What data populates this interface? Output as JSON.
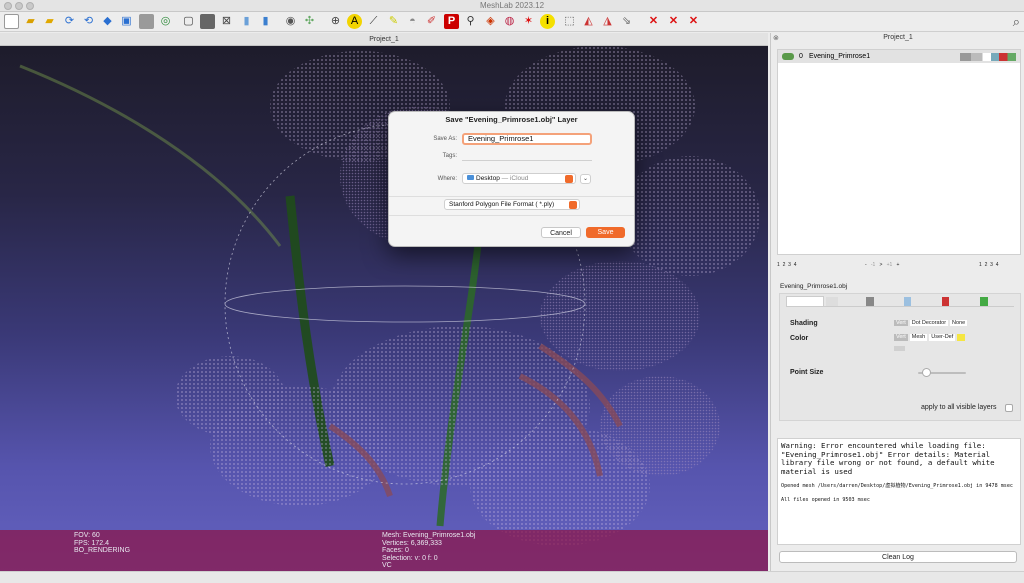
{
  "app": {
    "title": "MeshLab 2023.12"
  },
  "viewport": {
    "tab_title": "Project_1"
  },
  "info_left": {
    "fov": "FOV: 60",
    "fps": "FPS:   172.4",
    "render": "BO_RENDERING"
  },
  "info_right": {
    "mesh": "Mesh: Evening_Primrose1.obj",
    "vertices": "Vertices: 6,369,333",
    "faces": "Faces: 0",
    "selection": "Selection: v: 0 f: 0",
    "vc": "VC"
  },
  "dock": {
    "title": "Project_1"
  },
  "layers": [
    {
      "index": "0",
      "name": "Evening_Primrose1"
    }
  ],
  "pager": {
    "left": [
      "1",
      "2",
      "3",
      "4"
    ],
    "mid": [
      "-",
      "-1",
      ">",
      "+1",
      "+"
    ],
    "right": [
      "1",
      "2",
      "3",
      "4"
    ]
  },
  "panel": {
    "layer_name": "Evening_Primrose1.obj",
    "shading_label": "Shading",
    "shading_options": [
      "Vert",
      "Dot Decorator",
      "None"
    ],
    "color_label": "Color",
    "color_options": [
      "Vert",
      "Mesh",
      "User-Def"
    ],
    "user_color": "#f5e642",
    "point_size_label": "Point Size",
    "point_size_level": 0.1,
    "apply_all": "apply to all visible layers"
  },
  "log": {
    "warning": "Warning: Error encountered while loading file: \"Evening_Primrose1.obj\" Error details: Material library file wrong or not found, a default white material is used",
    "opened": "Opened mesh /Users/darren/Desktop/虚拟植物/Evening_Primrose1.obj in 9478 msec",
    "all_files": "All files opened in 9503 msec",
    "clean_label": "Clean Log"
  },
  "dialog": {
    "title": "Save \"Evening_Primrose1.obj\" Layer",
    "save_as_label": "Save As:",
    "save_as_value": "Evening_Primrose1",
    "tags_label": "Tags:",
    "where_label": "Where:",
    "where_value": "Desktop",
    "where_suffix": "— iCloud",
    "format_value": "Stanford Polygon File Format ( *.ply)",
    "cancel_label": "Cancel",
    "save_label": "Save"
  },
  "colors": {
    "accent": "#f06a2a",
    "info_bar": "#8c1446",
    "viewport_bottom": "#6462c0"
  },
  "toolbar_icons": [
    "new-icon",
    "open-icon",
    "open-folder-icon",
    "save-icon",
    "reload-icon",
    "reload-all-icon",
    "snapshot-icon",
    "camera-icon",
    "layers-icon",
    "stack-icon",
    "box-icon",
    "wireframe-icon",
    "points-icon",
    "flat-icon",
    "smooth-icon",
    "texture-icon",
    "sphere-icon",
    "axes-icon",
    "align-icon",
    "annotate-icon",
    "measure-icon",
    "paint-icon",
    "lamp-icon",
    "brush-icon",
    "pick-icon",
    "select-vertex-icon",
    "color-icon",
    "globe-icon",
    "star-icon",
    "info-icon",
    "select-icon",
    "select-faces-icon",
    "select-region-icon",
    "select-cut-icon",
    "delete-icon",
    "delete-faces-icon",
    "delete-vertices-icon"
  ]
}
